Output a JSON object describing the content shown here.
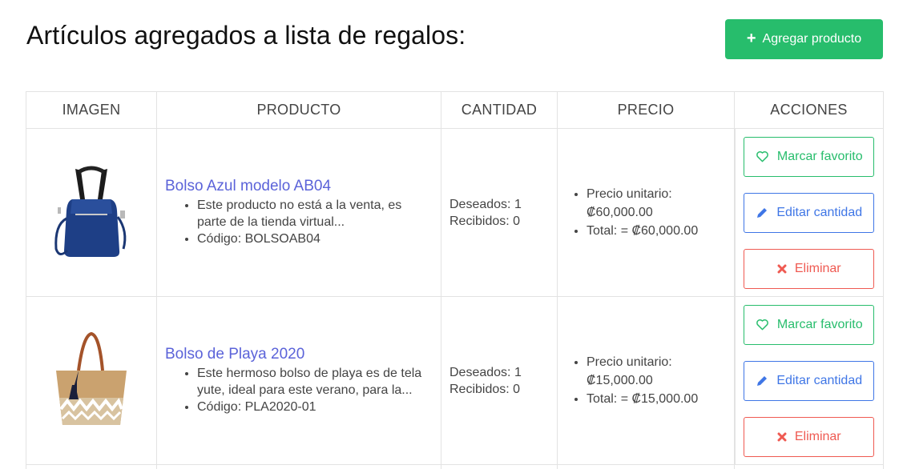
{
  "header": {
    "title": "Artículos agregados a lista de regalos:",
    "add_button_label": "Agregar producto",
    "add_button_icon": "plus-icon"
  },
  "table": {
    "columns": [
      "IMAGEN",
      "PRODUCTO",
      "CANTIDAD",
      "PRECIO",
      "ACCIONES"
    ],
    "rows": [
      {
        "image": "blue-backpack-bag-image",
        "name": "Bolso Azul modelo AB04",
        "description": "Este producto no está a la venta, es parte de la tienda virtual...",
        "code": "Código: BOLSOAB04",
        "wanted": "Deseados: 1",
        "received": "Recibidos: 0",
        "unit_price_label": "Precio unitario:",
        "unit_price": "₡60,000.00",
        "total": "Total: = ₡60,000.00",
        "actions": {
          "favorite": "Marcar favorito",
          "edit": "Editar cantidad",
          "delete": "Eliminar"
        }
      },
      {
        "image": "beach-tote-bag-image",
        "name": "Bolso de Playa 2020",
        "description": "Este hermoso bolso de playa es de tela yute, ideal para este verano, para la...",
        "code": "Código: PLA2020-01",
        "wanted": "Deseados: 1",
        "received": "Recibidos: 0",
        "unit_price_label": "Precio unitario:",
        "unit_price": "₡15,000.00",
        "total": "Total: = ₡15,000.00",
        "actions": {
          "favorite": "Marcar favorito",
          "edit": "Editar cantidad",
          "delete": "Eliminar"
        }
      }
    ]
  },
  "colors": {
    "primary_green": "#27bd6c",
    "edit_blue": "#3f76e6",
    "delete_red": "#ef5a52",
    "link_purple": "#5b63d9"
  }
}
